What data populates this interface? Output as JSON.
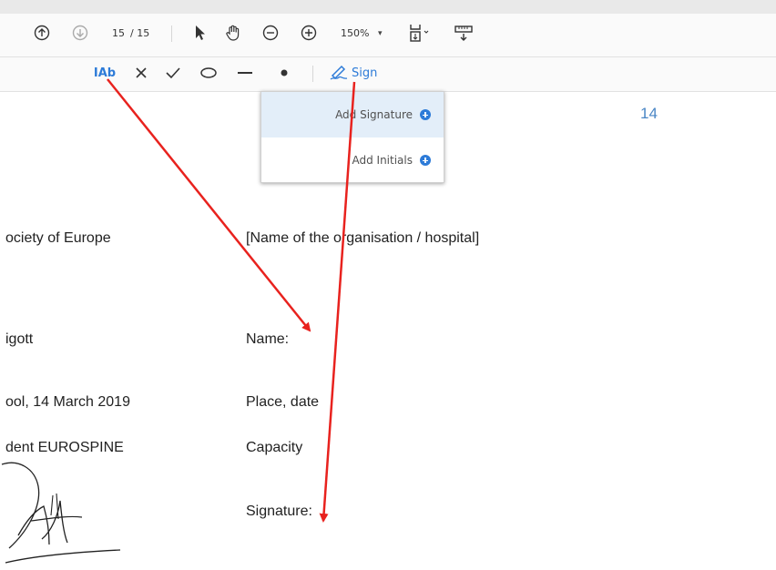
{
  "toolbar": {
    "page_current": "15",
    "page_total": "/ 15",
    "zoom": "150%",
    "icons": [
      "page-up-icon",
      "page-down-icon",
      "select-cursor-icon",
      "hand-tool-icon",
      "zoom-out-icon",
      "zoom-in-icon",
      "fit-page-icon",
      "scroll-mode-icon"
    ]
  },
  "fill_sign_toolbar": {
    "text_tool_label": "IAb",
    "sign_label": "Sign",
    "icons": [
      "add-text-icon",
      "cross-mark-icon",
      "check-mark-icon",
      "ellipse-icon",
      "line-icon",
      "dot-icon",
      "sign-pen-icon"
    ]
  },
  "sign_menu": {
    "items": [
      {
        "label": "Add Signature"
      },
      {
        "label": "Add Initials"
      }
    ]
  },
  "document": {
    "page_number": "14",
    "left_column": {
      "org": "ociety of Europe",
      "name": "igott",
      "place_date": "ool, 14 March 2019",
      "capacity": "dent EUROSPINE"
    },
    "right_column": {
      "org": "[Name of the organisation / hospital]",
      "name": "Name:",
      "place_date": "Place, date",
      "capacity": "Capacity",
      "signature": "Signature:"
    }
  },
  "colors": {
    "accent": "#2d7bd8",
    "arrow": "#e8221e",
    "menu_highlight": "#e3eef9"
  }
}
